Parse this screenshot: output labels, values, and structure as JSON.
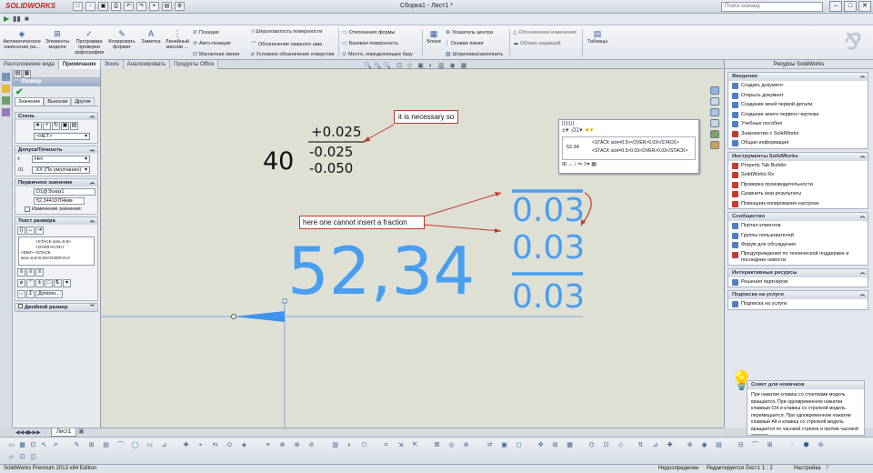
{
  "app": {
    "logo": "SOLIDWORKS",
    "window_title": "Сборка1 - Лист1 *",
    "search_placeholder": "Поиск команд",
    "win_min": "–",
    "win_max": "□",
    "win_close": "✕",
    "qat": [
      "□",
      "▫",
      "▣",
      "⎙",
      "↶",
      "↷",
      "⌖",
      "▤",
      "⚙"
    ]
  },
  "command_manager": {
    "big_buttons": [
      {
        "label": "Автоматическое нанесение ра...",
        "icon": "◈"
      },
      {
        "label": "Элементы модели",
        "icon": "⊞"
      },
      {
        "label": "Программа проверки орфографии",
        "icon": "✓"
      },
      {
        "label": "Копировать формат",
        "icon": "✎"
      },
      {
        "label": "Заметка",
        "icon": "A"
      },
      {
        "label": "Линейный массив ...",
        "icon": "⋮"
      }
    ],
    "col1": [
      "Позиция",
      "Авто-позиция",
      "Магнитная линия"
    ],
    "col2": [
      "Шероховатость поверхности",
      "Обозначение сварного шва",
      "Условное обозначение отверстия"
    ],
    "col3": [
      "Отклонения формы",
      "Базовая поверхность",
      "Место, определяющее базу"
    ],
    "blocks": "Блоки",
    "col4": [
      "Указатель центра",
      "Осевая линия",
      "Штриховка/заполнить"
    ],
    "col5": [
      "Обозначение изменения",
      "Облако редакций"
    ],
    "tables": "Таблицы"
  },
  "tabs": [
    "Расположение вида",
    "Примечание",
    "Эскиз",
    "Анализировать",
    "Продукты Office"
  ],
  "property_manager": {
    "title": "Размер",
    "subtabs": [
      "Значение",
      "Выноски",
      "Другие"
    ],
    "style": {
      "header": "Стиль",
      "value": "<НЕТ>"
    },
    "tolerance": {
      "header": "Допуск/Точность",
      "tol": "Нет",
      "precision": ".XX (По умолчанию)"
    },
    "primary": {
      "header": "Первичное значение",
      "name": "D1@Эскиз1",
      "value": "52,34419704мм",
      "override": "Изменение значения:"
    },
    "dimtext": {
      "header": "Текст размера",
      "line1": "<STACK size=0.5><OVER>0.03</",
      "line2": "<DIM> <STACK size=0.5>0.03<OVER>0.0",
      "more": "Дополн..."
    },
    "dual": "Двойной размер"
  },
  "canvas": {
    "tol_upper": "+0.025",
    "tol_mid": "-0.025",
    "tol_nominal": "40",
    "tol_lower": "-0.050",
    "note1": "it is necessary so",
    "note2": "here one cannot insert a fraction",
    "big_dim": "52,34",
    "frac": [
      "0.03",
      "0.03",
      "0.03"
    ],
    "popup": {
      "col_value": "52.34",
      "row1": "<STACK size=0.5><OVER>0.03</STACK>",
      "row2": "<STACK size=0.5>0.03<OVER>0.03</STACK>"
    }
  },
  "right_panel": {
    "title": "Ресурсы SolidWorks",
    "intro": {
      "header": "Введение",
      "items": [
        "Создать документ",
        "Открыть документ",
        "Создание моей первой детали",
        "Создание моего первого чертежа",
        "Учебные пособия",
        "Знакомство с SolidWorks",
        "Общая информация"
      ]
    },
    "tools": {
      "header": "Инструменты SolidWorks",
      "items": [
        "Property Tab Builder",
        "SolidWorks Rx",
        "Проверка производительности",
        "Сравнить мои результаты",
        "Помощник копирования настроек"
      ]
    },
    "community": {
      "header": "Сообщество",
      "items": [
        "Портал клиентов",
        "Группы пользователей",
        "Форум для обсуждения",
        "Предупреждения по технической поддержке и последние новости"
      ]
    },
    "online": {
      "header": "Интерактивные ресурсы",
      "items": [
        "Решения партнеров"
      ]
    },
    "subscription": {
      "header": "Подписка на услуги",
      "items": [
        "Подписка на услуги"
      ]
    },
    "tip": {
      "header": "Совет для новичков",
      "text": "При нажатии клавиш со стрелками модель вращается. При одновременном нажатии клавиши Ctrl и клавиш со стрелкой модель перемещается. При одновременном нажатии клавиши Alt и клавиш со стрелкой модель вращается по часовой стрелке и против часовой стрелки."
    }
  },
  "sheet": {
    "tab": "Лист1"
  },
  "status": {
    "edition": "SolidWorks Premium 2013 x64 Edition",
    "state": "Недоопределен",
    "editing": "Редактируется Лист1",
    "scale": "1 : 2",
    "settings": "Настройка"
  },
  "colors": {
    "dim_blue": "#4a9eef",
    "note_red": "#c0392b",
    "canvas_bg": "#dfe0d4"
  }
}
